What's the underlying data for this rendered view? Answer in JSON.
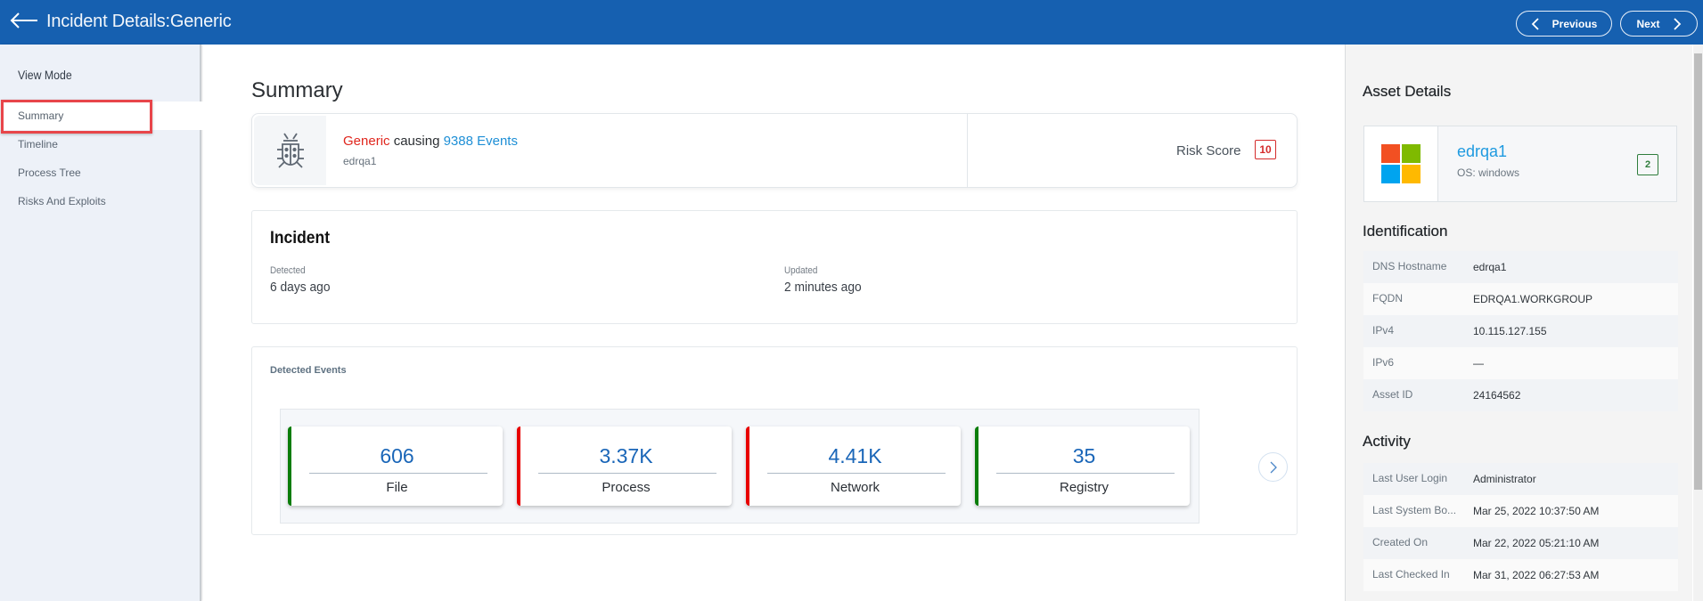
{
  "header": {
    "title": "Incident Details:Generic",
    "previous_label": "Previous",
    "next_label": "Next",
    "bg_color": "#1660b0"
  },
  "sidebar": {
    "title": "View Mode",
    "items": [
      {
        "label": "Summary",
        "active": true
      },
      {
        "label": "Timeline",
        "active": false
      },
      {
        "label": "Process Tree",
        "active": false
      },
      {
        "label": "Risks And Exploits",
        "active": false
      }
    ]
  },
  "summary": {
    "title": "Summary",
    "threat_name": "Generic",
    "causing_text": "causing",
    "events_link": "9388 Events",
    "host": "edrqa1",
    "risk_label": "Risk Score",
    "risk_score": "10",
    "icon": "bug-icon"
  },
  "incident": {
    "title": "Incident",
    "detected_label": "Detected",
    "detected_value": "6 days ago",
    "updated_label": "Updated",
    "updated_value": "2 minutes ago"
  },
  "detected_events": {
    "title": "Detected Events",
    "cards": [
      {
        "value": "606",
        "label": "File",
        "color": "#0a7d0a"
      },
      {
        "value": "3.37K",
        "label": "Process",
        "color": "#e80000"
      },
      {
        "value": "4.41K",
        "label": "Network",
        "color": "#e80000"
      },
      {
        "value": "35",
        "label": "Registry",
        "color": "#0a7d0a"
      },
      {
        "value": "",
        "label": "",
        "color": "#0000ee"
      }
    ]
  },
  "asset": {
    "title": "Asset Details",
    "name": "edrqa1",
    "os": "OS: windows",
    "badge": "2",
    "logo_colors": [
      "#f25022",
      "#7fba00",
      "#00a4ef",
      "#ffb900"
    ]
  },
  "identification": {
    "title": "Identification",
    "rows": [
      {
        "key": "DNS Hostname",
        "value": "edrqa1"
      },
      {
        "key": "FQDN",
        "value": "EDRQA1.WORKGROUP"
      },
      {
        "key": "IPv4",
        "value": "10.115.127.155"
      },
      {
        "key": "IPv6",
        "value": "—"
      },
      {
        "key": "Asset ID",
        "value": "24164562"
      }
    ]
  },
  "activity": {
    "title": "Activity",
    "rows": [
      {
        "key": "Last User Login",
        "value": "Administrator"
      },
      {
        "key": "Last System Bo...",
        "value": "Mar 25, 2022 10:37:50 AM"
      },
      {
        "key": "Created On",
        "value": "Mar 22, 2022 05:21:10 AM"
      },
      {
        "key": "Last Checked In",
        "value": "Mar 31, 2022 06:27:53 AM"
      }
    ]
  }
}
